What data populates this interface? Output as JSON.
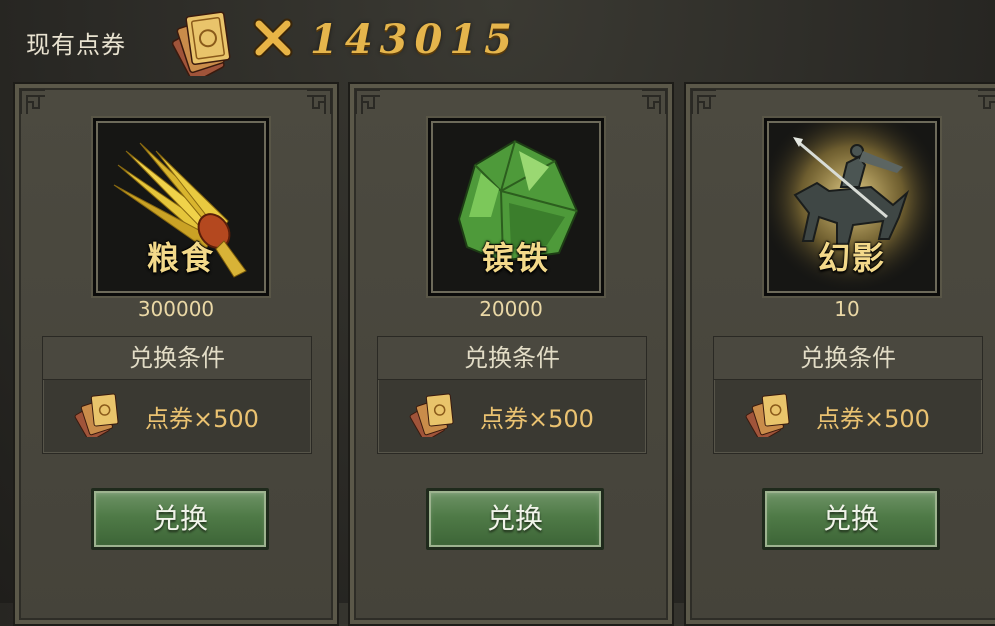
{
  "balance": {
    "label": "现有点券",
    "multiplier_icon": "times-icon",
    "value": "143015",
    "currency_icon": "voucher-stack-icon"
  },
  "colors": {
    "card_bg": "#4c4a40",
    "gold_text": "#e5b54c",
    "button_green": "#4f7a47",
    "cost_text": "#eac271"
  },
  "items": [
    {
      "name": "粮食",
      "quantity": "300000",
      "icon": "grain-bundle-icon",
      "condition_title": "兑换条件",
      "cost_icon": "voucher-icon",
      "cost_text": "点券×500",
      "button_label": "兑换"
    },
    {
      "name": "镔铁",
      "quantity": "20000",
      "icon": "iron-ore-icon",
      "condition_title": "兑换条件",
      "cost_icon": "voucher-icon",
      "cost_text": "点券×500",
      "button_label": "兑换"
    },
    {
      "name": "幻影",
      "quantity": "10",
      "icon": "phantom-cavalry-icon",
      "condition_title": "兑换条件",
      "cost_icon": "voucher-icon",
      "cost_text": "点券×500",
      "button_label": "兑换"
    }
  ]
}
